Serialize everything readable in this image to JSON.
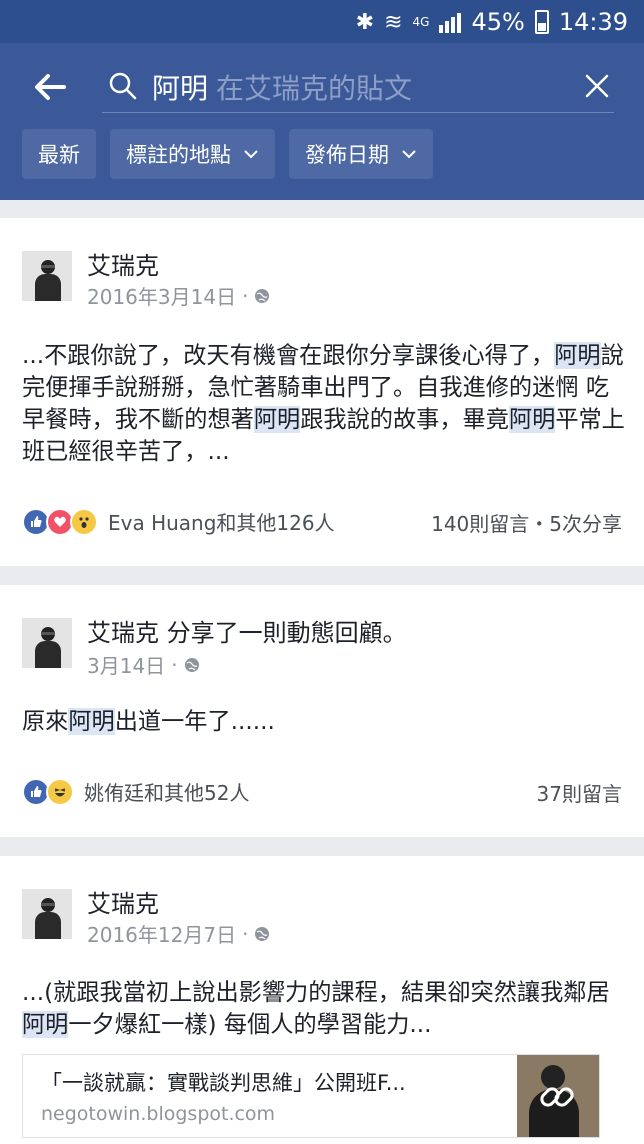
{
  "status_bar": {
    "battery": "45%",
    "time": "14:39",
    "network": "4G",
    "icons": [
      "bluetooth-icon",
      "wifi-icon",
      "signal-icon",
      "battery-icon"
    ]
  },
  "search": {
    "query": "阿明",
    "placeholder": "在艾瑞克的貼文",
    "filters": [
      {
        "label": "最新"
      },
      {
        "label": "標註的地點"
      },
      {
        "label": "發佈日期"
      }
    ]
  },
  "posts": [
    {
      "author": "艾瑞克",
      "date": "2016年3月14日",
      "text": [
        {
          "t": "...不跟你說了，改天有機會在跟你分享課後心得了，"
        },
        {
          "t": "阿明",
          "hl": true
        },
        {
          "t": "說完便揮手說掰掰，急忙著騎車出門了。自我進修的迷惘 吃早餐時，我不斷的想著"
        },
        {
          "t": "阿明",
          "hl": true
        },
        {
          "t": "跟我說的故事，畢竟"
        },
        {
          "t": "阿明",
          "hl": true
        },
        {
          "t": "平常上班已經很辛苦了，..."
        }
      ],
      "reactions": [
        "like",
        "love",
        "wow"
      ],
      "reaction_text": "Eva Huang和其他126人",
      "counts": "140則留言・5次分享"
    },
    {
      "author": "艾瑞克 分享了一則動態回顧。",
      "date": "3月14日",
      "text": [
        {
          "t": "原來"
        },
        {
          "t": "阿明",
          "hl": true
        },
        {
          "t": "出道一年了......"
        }
      ],
      "reactions": [
        "like",
        "haha"
      ],
      "reaction_text": "姚侑廷和其他52人",
      "counts": "37則留言"
    },
    {
      "author": "艾瑞克",
      "date": "2016年12月7日",
      "text": [
        {
          "t": "...(就跟我當初上說出影響力的課程，結果卻突然讓我鄰居"
        },
        {
          "t": "阿明",
          "hl": true
        },
        {
          "t": "一夕爆紅一樣) 每個人的學習能力..."
        }
      ],
      "link": {
        "title": "「一談就贏：實戰談判思維」公開班F...",
        "domain": "negotowin.blogspot.com"
      }
    }
  ],
  "colors": {
    "header": "#3b5998",
    "status_bar": "#2e4f8e",
    "highlight": "#dbe5f4",
    "like": "#4267b2",
    "love": "#f25268"
  }
}
